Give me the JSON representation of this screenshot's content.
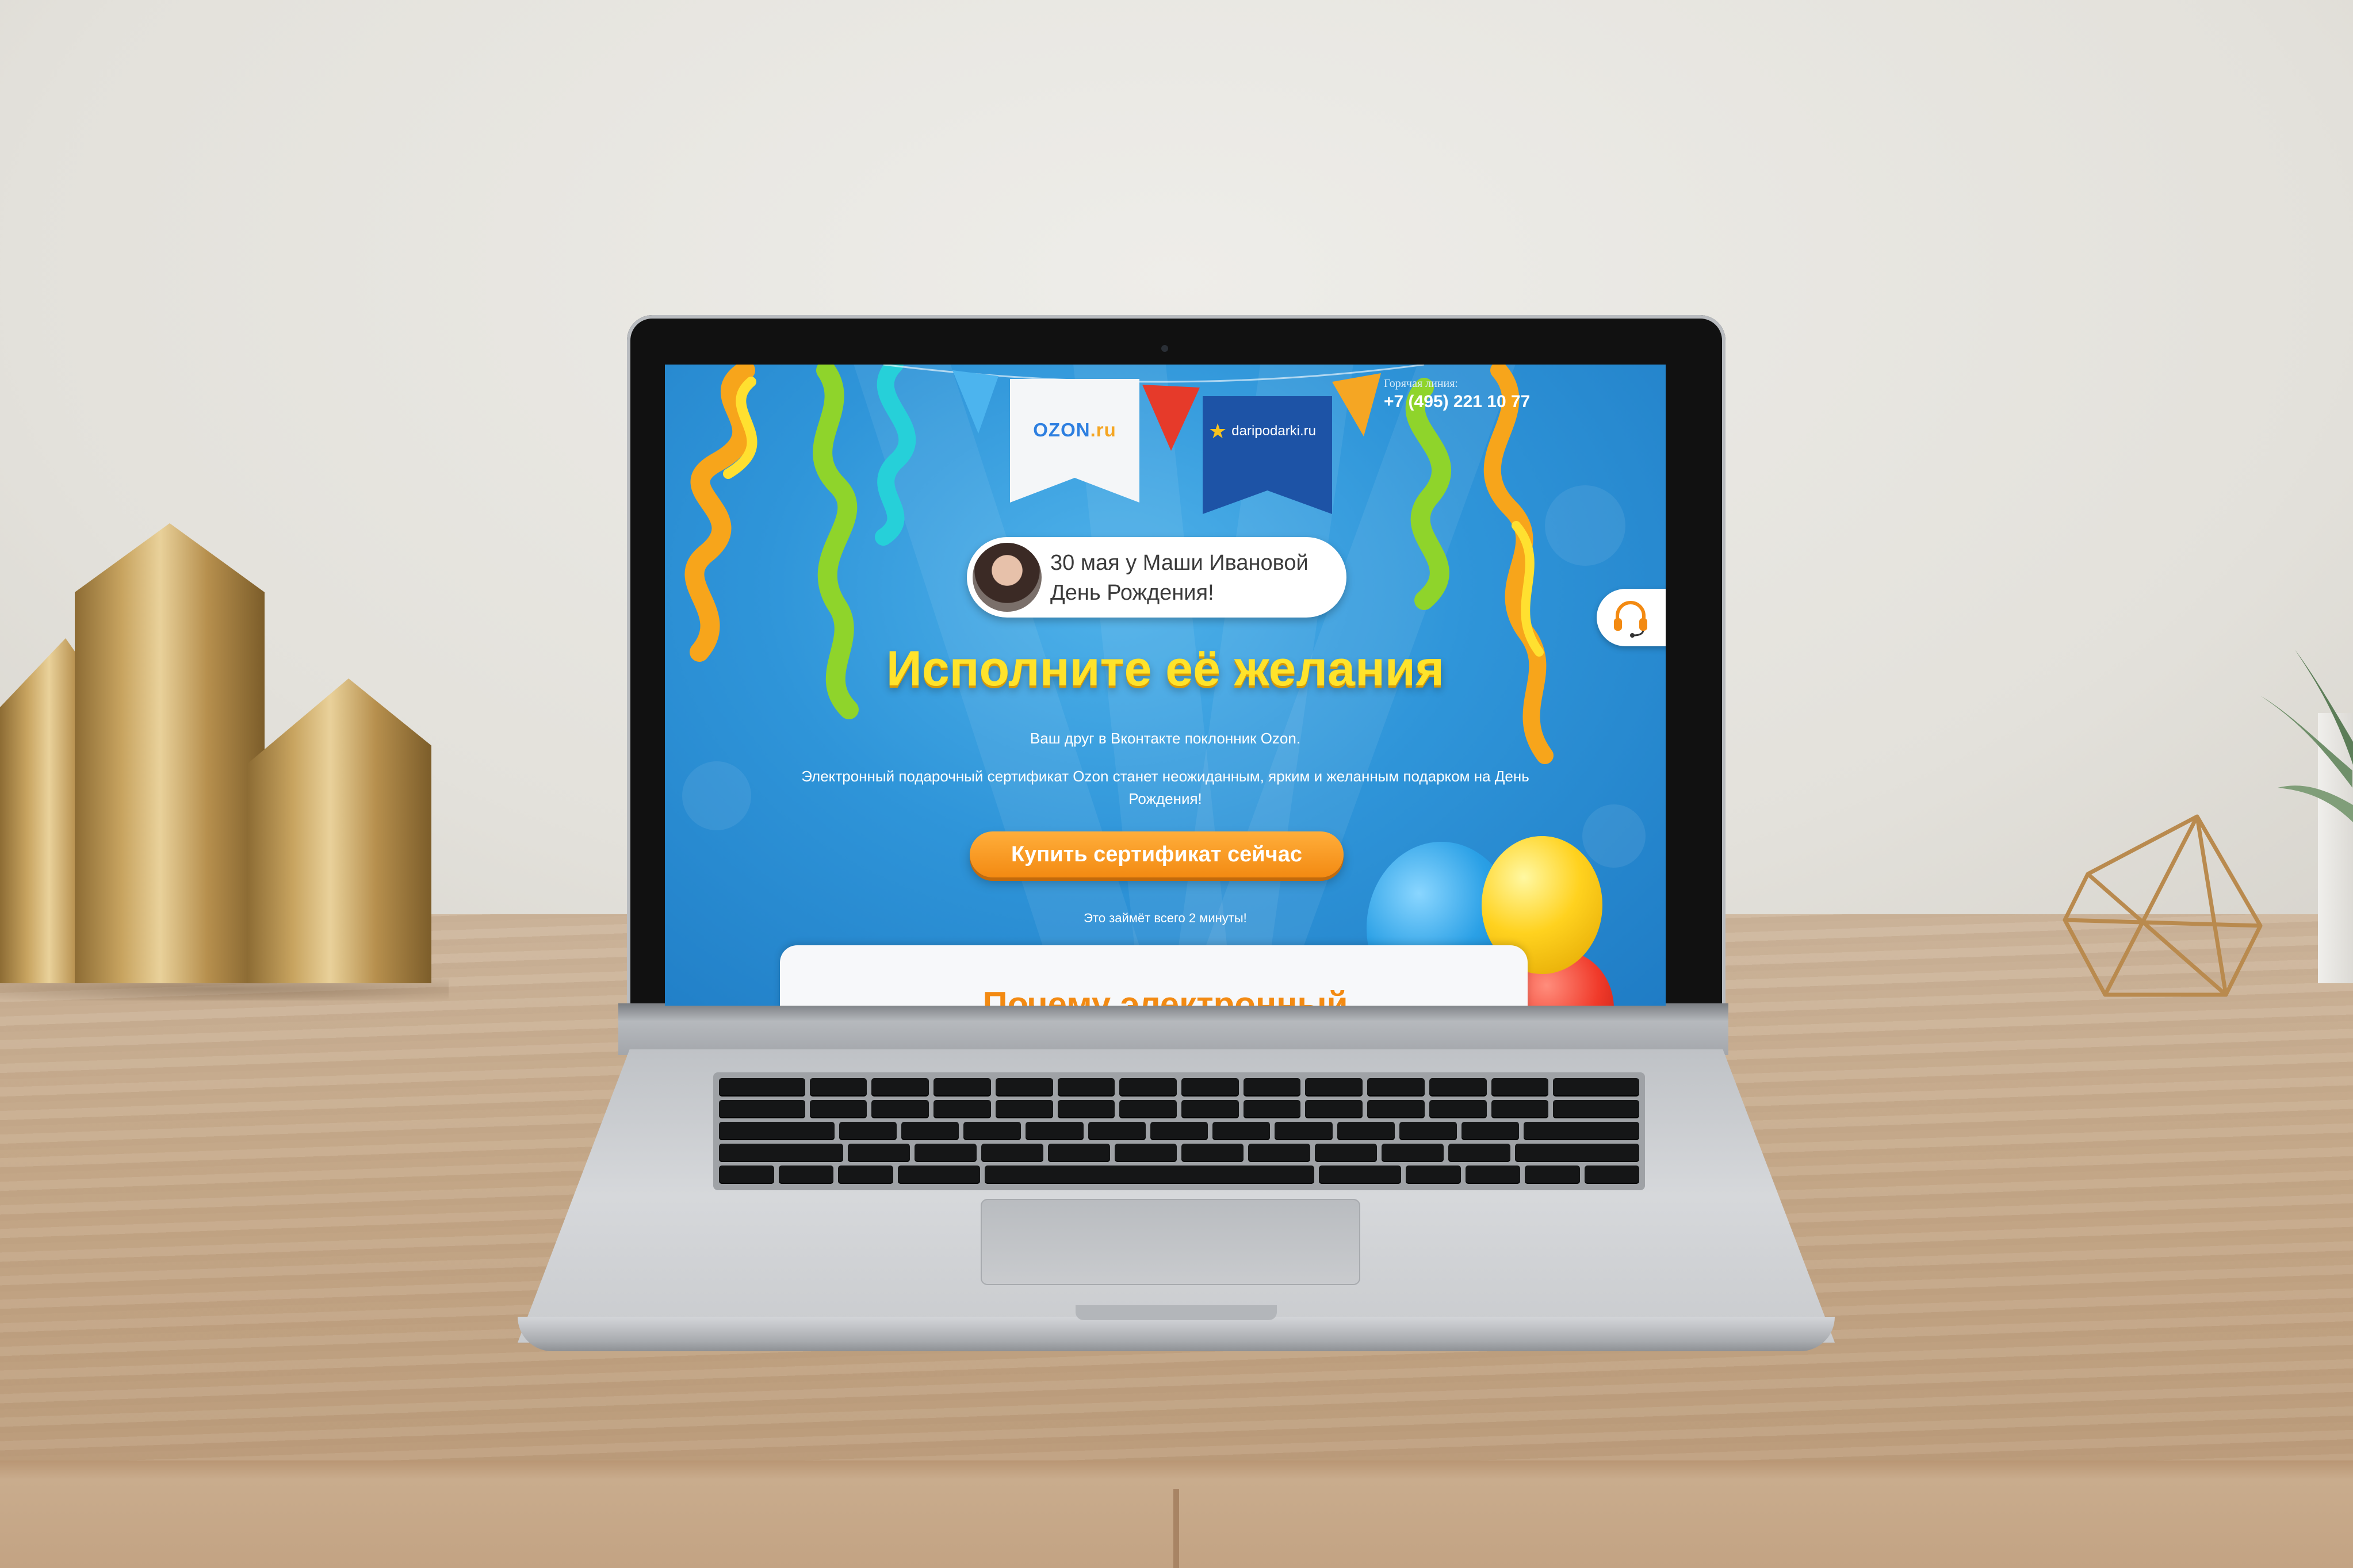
{
  "page": {
    "flags": {
      "ozon": {
        "brand": "OZON",
        "tld": ".ru"
      },
      "dari": {
        "label": "daripodarki.ru"
      }
    },
    "hotline": {
      "label": "Горячая линия:",
      "phone": "+7 (495) 221 10 77"
    },
    "bubble": {
      "line1": "30 мая у Маши Ивановой",
      "line2": "День Рождения!"
    },
    "headline": "Исполните её желания",
    "sub1": "Ваш друг в Вконтакте поклонник Ozon.",
    "sub2": "Электронный подарочный сертификат Ozon станет неожиданным, ярким и желанным подарком на День Рождения!",
    "buy_button": "Купить сертификат сейчас",
    "note": "Это займёт всего 2 минуты!",
    "section_title": "Почему электронный"
  },
  "colors": {
    "screen_blue": "#2f95d9",
    "headline_yellow": "#ffe32b",
    "button_orange": "#f38a12",
    "ozon_blue": "#2d7fe0",
    "dari_blue": "#1d53a6"
  },
  "icons": {
    "support": "headset-icon",
    "dari_star": "star-icon"
  }
}
